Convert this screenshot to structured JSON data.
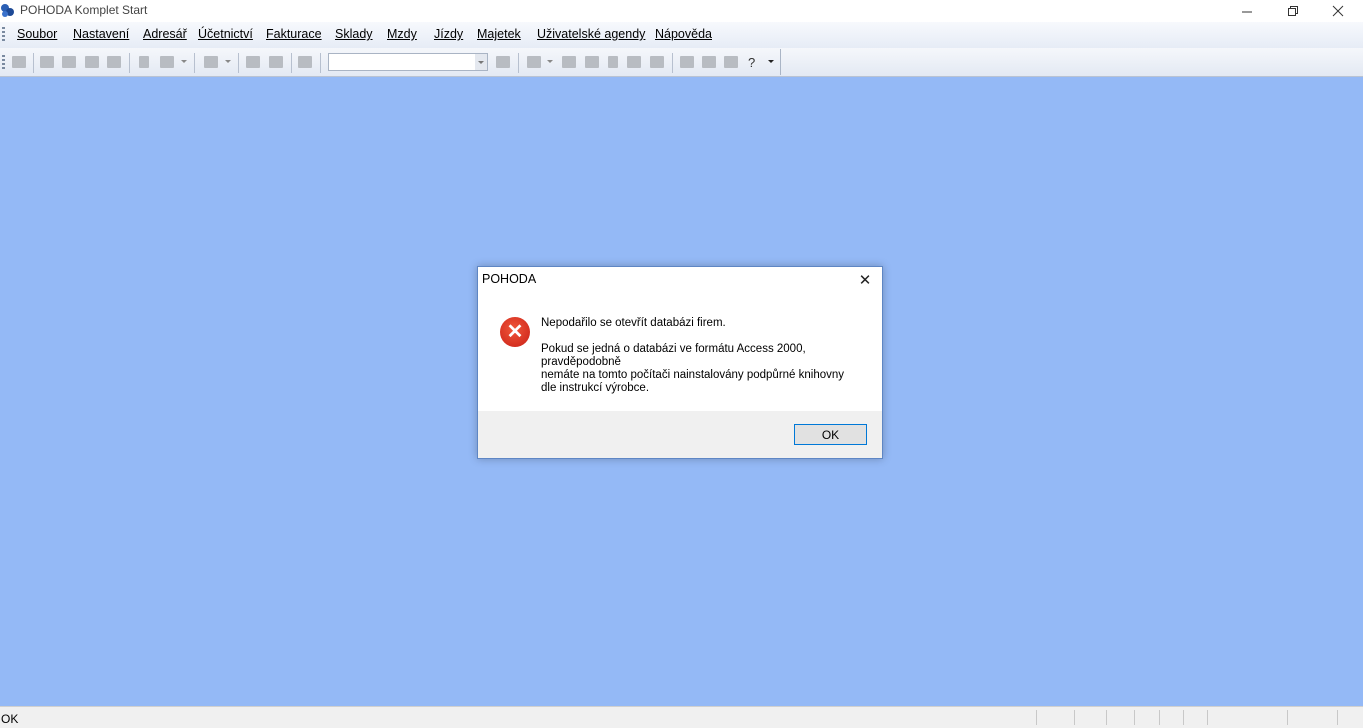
{
  "window": {
    "title": "POHODA Komplet Start",
    "icons": {
      "app": "pohoda-app-icon",
      "minimize": "minimize-icon",
      "maximize": "restore-icon",
      "close": "close-icon"
    }
  },
  "menu": {
    "items": [
      {
        "label": "Soubor"
      },
      {
        "label": "Nastavení"
      },
      {
        "label": "Adresář"
      },
      {
        "label": "Účetnictví"
      },
      {
        "label": "Fakturace"
      },
      {
        "label": "Sklady"
      },
      {
        "label": "Mzdy"
      },
      {
        "label": "Jízdy"
      },
      {
        "label": "Majetek"
      },
      {
        "label": "Uživatelské agendy"
      },
      {
        "label": "Nápověda"
      }
    ]
  },
  "toolbar": {
    "combo_value": "",
    "help_glyph": "?"
  },
  "dialog": {
    "title": "POHODA",
    "message": "Nepodařilo se otevřít databázi firem.\n\nPokud se jedná o databázi ve formátu Access 2000,\npravděpodobně\nnemáte na tomto počítači nainstalovány podpůrné knihovny\ndle instrukcí výrobce.",
    "ok_label": "OK",
    "close_glyph": "✕",
    "error_glyph": "✕"
  },
  "status": {
    "text": "OK"
  },
  "colors": {
    "workspace": "#94b9f6",
    "dialog_border": "#5e86c4",
    "error_red": "#e43d27",
    "button_focus": "#0078d7"
  }
}
